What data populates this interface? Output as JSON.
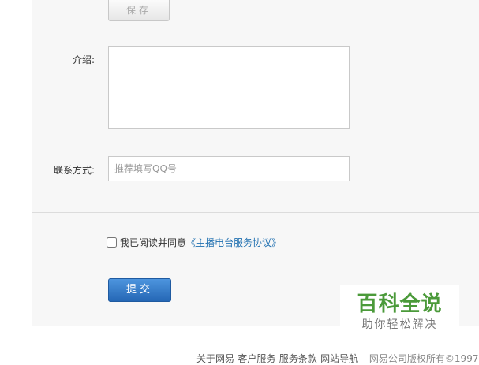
{
  "form": {
    "save_label": "保存",
    "intro_label": "介绍:",
    "intro_value": "",
    "contact_label": "联系方式:",
    "contact_placeholder": "推荐填写QQ号",
    "agree_text": "我已阅读并同意",
    "agree_link": "《主播电台服务协议》",
    "agree_checked": false,
    "submit_label": "提交"
  },
  "footer": {
    "links": [
      "关于网易",
      "客户服务",
      "服务条款",
      "网站导航"
    ],
    "separator": "-",
    "copyright": "网易公司版权所有©1997"
  },
  "watermark": {
    "title": "百科全说",
    "subtitle": "助你轻松解决"
  },
  "colors": {
    "panel_bg": "#f7f7f7",
    "submit_blue": "#2567b5",
    "link_blue": "#1f6fb0",
    "watermark_green": "#4b9a3a"
  }
}
